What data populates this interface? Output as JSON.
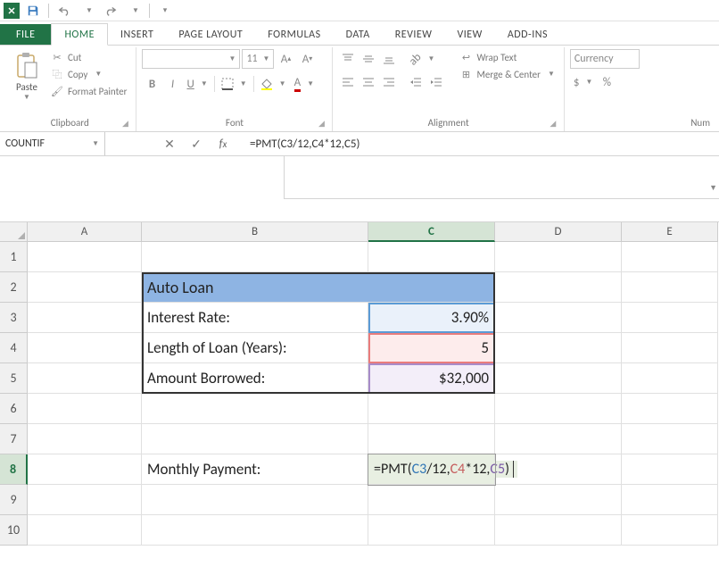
{
  "qat": {
    "save": "save",
    "undo": "undo",
    "redo": "redo"
  },
  "tabs": [
    "FILE",
    "HOME",
    "INSERT",
    "PAGE LAYOUT",
    "FORMULAS",
    "DATA",
    "REVIEW",
    "VIEW",
    "ADD-INS"
  ],
  "ribbon": {
    "clipboard": {
      "label": "Clipboard",
      "paste": "Paste",
      "cut": "Cut",
      "copy": "Copy",
      "painter": "Format Painter"
    },
    "font": {
      "label": "Font",
      "name": "",
      "size": "11",
      "bold": "B",
      "italic": "I",
      "underline": "U"
    },
    "alignment": {
      "label": "Alignment",
      "wrap": "Wrap Text",
      "merge": "Merge & Center"
    },
    "number": {
      "label": "Num",
      "format": "Currency",
      "dollar": "$",
      "percent": "%"
    }
  },
  "nameBox": "COUNTIF",
  "formulaBar": "=PMT(C3/12,C4*12,C5)",
  "columns": [
    "A",
    "B",
    "C",
    "D",
    "E"
  ],
  "rows": [
    "1",
    "2",
    "3",
    "4",
    "5",
    "6",
    "7",
    "8",
    "9",
    "10"
  ],
  "cells": {
    "b2": "Auto Loan",
    "b3": "Interest Rate:",
    "c3": "3.90%",
    "b4": "Length of Loan (Years):",
    "c4": "5",
    "b5": "Amount Borrowed:",
    "c5": "$32,000",
    "b8": "Monthly Payment:",
    "c8": {
      "prefix": "=PMT(",
      "r1": "C3",
      "s1": "/12,",
      "r2": "C4",
      "s2": "*12,",
      "r3": "C5",
      "suffix": ")"
    }
  },
  "chart_data": {
    "type": "table",
    "title": "Auto Loan",
    "rows": [
      {
        "label": "Interest Rate:",
        "value": 0.039,
        "display": "3.90%"
      },
      {
        "label": "Length of Loan (Years):",
        "value": 5,
        "display": "5"
      },
      {
        "label": "Amount Borrowed:",
        "value": 32000,
        "display": "$32,000"
      }
    ],
    "formula_cell": {
      "label": "Monthly Payment:",
      "formula": "=PMT(C3/12,C4*12,C5)"
    }
  }
}
